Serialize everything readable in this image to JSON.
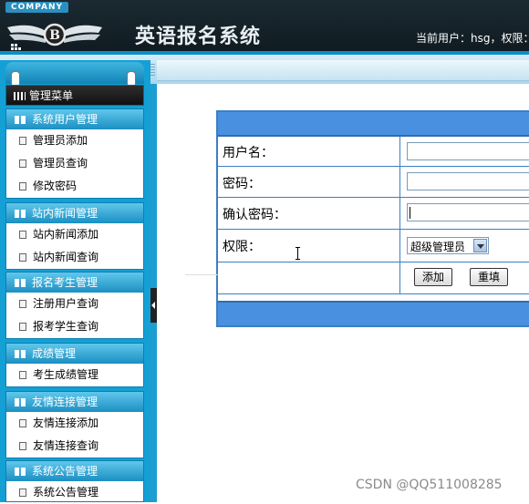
{
  "header": {
    "company": "COMPANY",
    "title": "英语报名系统",
    "user_info": "当前用户：hsg，权限："
  },
  "sidebar": {
    "menu_title": "管理菜单",
    "groups": [
      {
        "title": "系统用户管理",
        "items": [
          "管理员添加",
          "管理员查询",
          "修改密码"
        ]
      },
      {
        "title": "站内新闻管理",
        "items": [
          "站内新闻添加",
          "站内新闻查询"
        ]
      },
      {
        "title": "报名考生管理",
        "items": [
          "注册用户查询",
          "报考学生查询"
        ]
      },
      {
        "title": "成绩管理",
        "items": [
          "考生成绩管理"
        ]
      },
      {
        "title": "友情连接管理",
        "items": [
          "友情连接添加",
          "友情连接查询"
        ]
      },
      {
        "title": "系统公告管理",
        "items": [
          "系统公告管理"
        ]
      }
    ]
  },
  "form": {
    "username_label": "用户名：",
    "password_label": "密码：",
    "confirm_label": "确认密码：",
    "role_label": "权限：",
    "role_selected": "超级管理员",
    "add_button": "添加",
    "reset_button": "重填"
  },
  "watermark": "CSDN @QQ511008285"
}
